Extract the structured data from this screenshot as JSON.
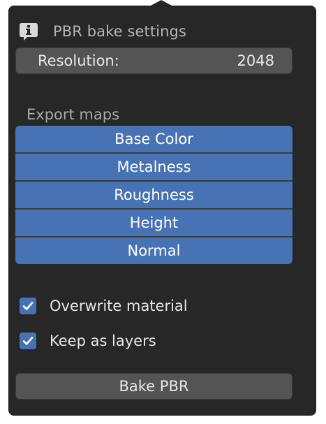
{
  "header": {
    "title": "PBR bake settings",
    "icon": "info-icon"
  },
  "resolution": {
    "label": "Resolution:",
    "value": "2048"
  },
  "export_maps": {
    "label": "Export maps",
    "items": [
      "Base Color",
      "Metalness",
      "Roughness",
      "Height",
      "Normal"
    ]
  },
  "options": {
    "overwrite_material": {
      "label": "Overwrite material",
      "checked": true
    },
    "keep_as_layers": {
      "label": "Keep as layers",
      "checked": true
    }
  },
  "bake_button": {
    "label": "Bake PBR"
  },
  "colors": {
    "panel_bg": "#272727",
    "accent": "#4772b3",
    "field_bg": "#545454"
  }
}
